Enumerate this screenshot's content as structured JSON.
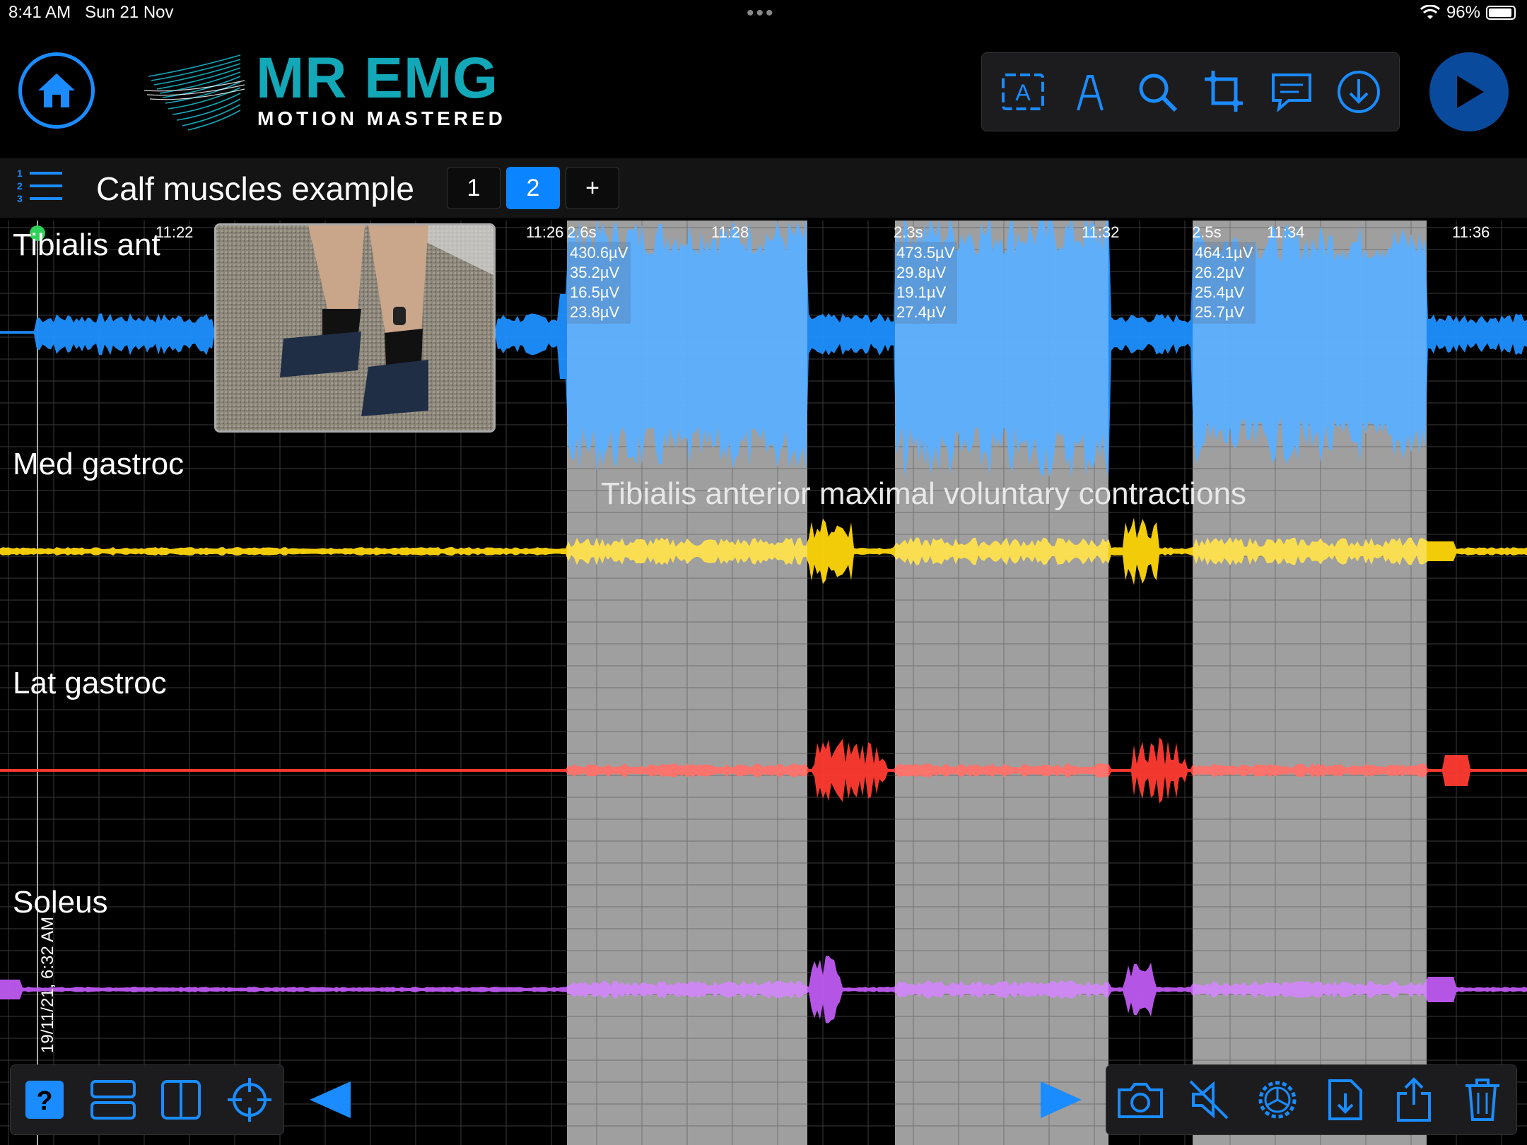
{
  "status": {
    "time": "8:41 AM",
    "date": "Sun 21 Nov",
    "battery": "96%"
  },
  "app": {
    "title": "MR EMG",
    "subtitle": "MOTION MASTERED"
  },
  "toolbar": {
    "items": [
      "text-label-icon",
      "pen-icon",
      "search-icon",
      "crop-icon",
      "comment-icon",
      "download-icon"
    ]
  },
  "session": {
    "title": "Calf muscles example",
    "tabs": [
      "1",
      "2",
      "+"
    ],
    "active_tab": "2"
  },
  "channels": [
    {
      "name": "Tibialis ant",
      "color": "#1e90ff"
    },
    {
      "name": "Med gastroc",
      "color": "#ffd60a"
    },
    {
      "name": "Lat gastroc",
      "color": "#ff3b30"
    },
    {
      "name": "Soleus",
      "color": "#bf5af2"
    }
  ],
  "time_ticks": [
    "11:22",
    "11:26",
    "11:28",
    "11:32",
    "11:34",
    "11:36"
  ],
  "segments": [
    {
      "duration": "2.6s",
      "stats": [
        "430.6µV",
        "35.2µV",
        "16.5µV",
        "23.8µV"
      ]
    },
    {
      "duration": "2.3s",
      "stats": [
        "473.5µV",
        "29.8µV",
        "19.1µV",
        "27.4µV"
      ]
    },
    {
      "duration": "2.5s",
      "stats": [
        "464.1µV",
        "26.2µV",
        "25.4µV",
        "25.7µV"
      ]
    }
  ],
  "annotation": "Tibialis anterior maximal voluntary contractions",
  "recording_date": "19/11/21, 6:32 AM",
  "bottom_left_icons": [
    "help-icon",
    "stacked-view-icon",
    "split-view-icon",
    "crosshair-icon"
  ],
  "bottom_right_icons": [
    "camera-icon",
    "mute-icon",
    "settings-gear-icon",
    "export-file-icon",
    "share-icon",
    "trash-icon"
  ]
}
